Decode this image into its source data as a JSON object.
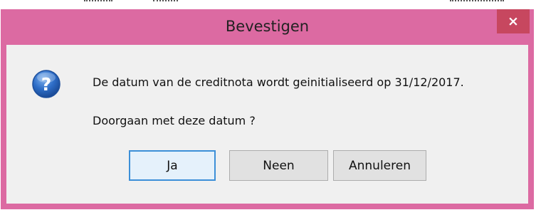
{
  "dialog": {
    "title": "Bevestigen",
    "close_icon": "close-icon",
    "close_label": "×",
    "message_icon": "question-icon",
    "message_line1": "De datum van de creditnota wordt geinitialiseerd op 31/12/2017.",
    "message_line2": "Doorgaan met deze datum ?",
    "buttons": {
      "yes": "Ja",
      "no": "Neen",
      "cancel": "Annuleren"
    }
  },
  "colors": {
    "titlebar": "#dc6aa2",
    "close_button": "#c7475f",
    "client_area": "#f0f0f0",
    "default_button_border": "#3c8fd8"
  }
}
